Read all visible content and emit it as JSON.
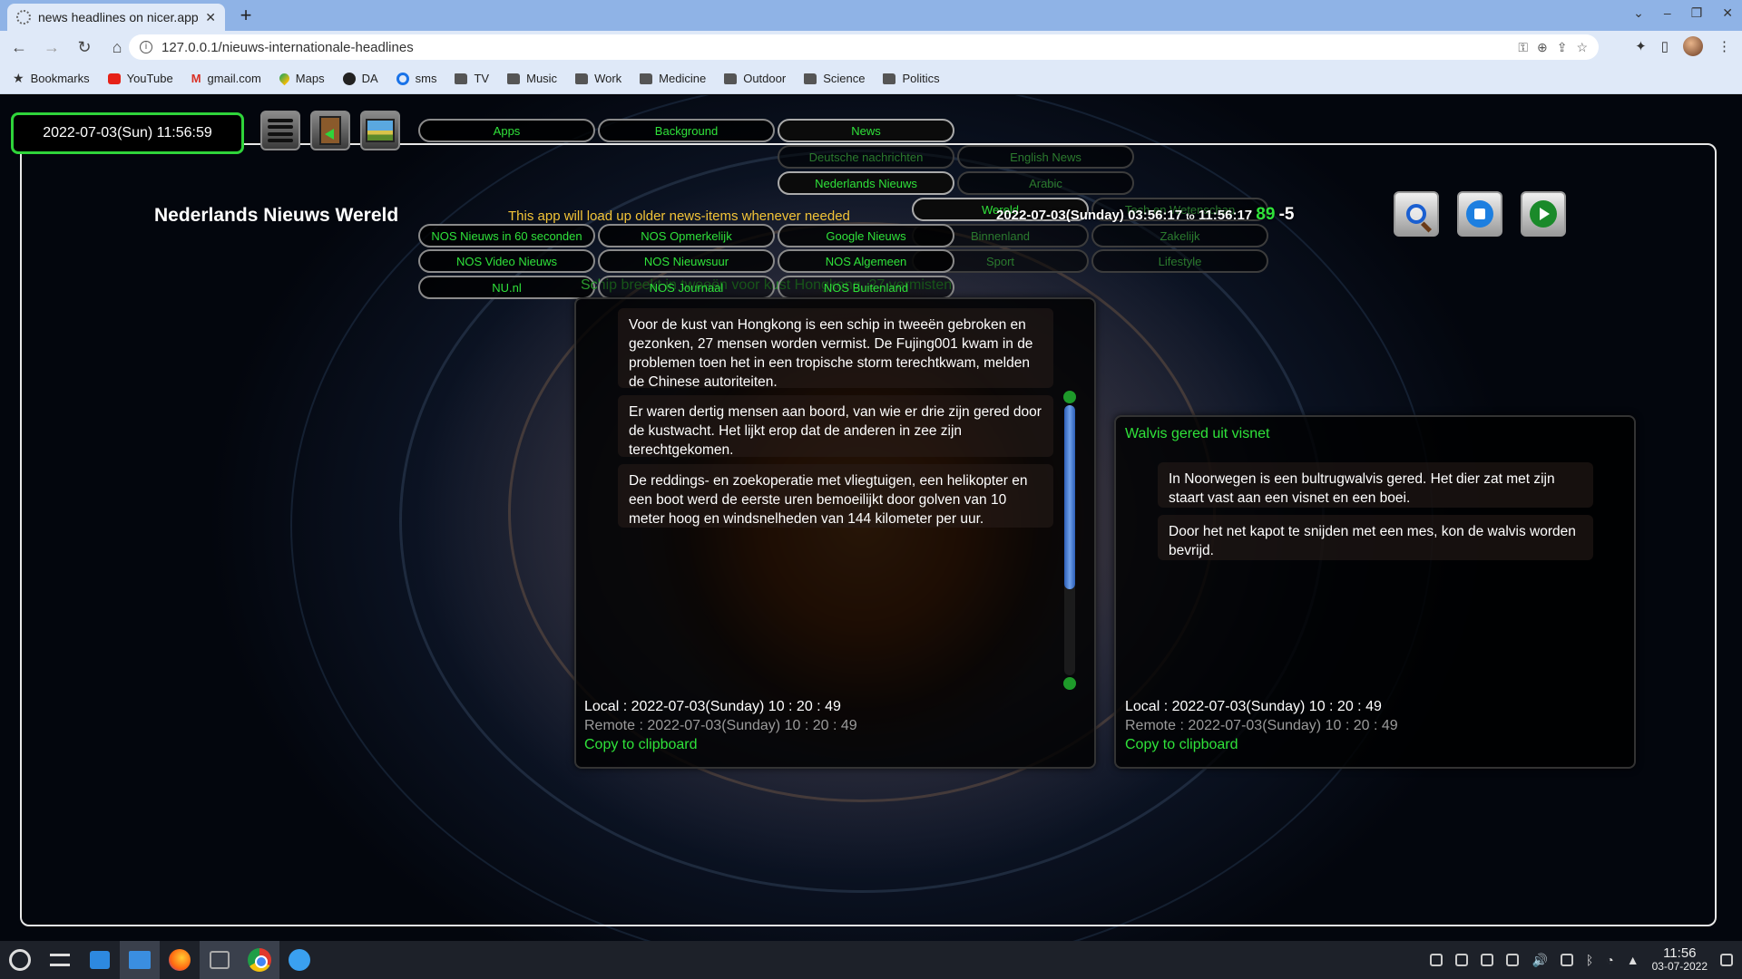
{
  "browser": {
    "tab_title": "news headlines on nicer.app",
    "url": "127.0.0.1/nieuws-internationale-headlines",
    "bookmarks": [
      "Bookmarks",
      "YouTube",
      "gmail.com",
      "Maps",
      "DA",
      "sms",
      "TV",
      "Music",
      "Work",
      "Medicine",
      "Outdoor",
      "Science",
      "Politics"
    ]
  },
  "page": {
    "clock": "2022-07-03(Sun) 11:56:59",
    "app_title": "Nederlands Nieuws Wereld",
    "info_text": "This app will load up older news-items whenever needed",
    "timeline": {
      "start": "2022-07-03(Sunday) 03:56:17",
      "to": "to",
      "end": "11:56:17",
      "count": "89",
      "offset": "-5"
    },
    "ghost_headline": "Schip breekt in tweeën voor kust Hongkong, 27 vermisten",
    "top_menu": [
      "Apps",
      "Background",
      "News"
    ],
    "news_submenu": [
      "Deutsche nachrichten",
      "English News",
      "Nederlands Nieuws",
      "Arabic"
    ],
    "nl_categories": [
      "Wereld",
      "Tech en Wetenschap",
      "Binnenland",
      "Zakelijk",
      "Sport",
      "Lifestyle"
    ],
    "feeds": [
      [
        "NOS Nieuws in 60 seconden",
        "NOS Opmerkelijk",
        "Google Nieuws"
      ],
      [
        "NOS Video Nieuws",
        "NOS Nieuwsuur",
        "NOS Algemeen"
      ],
      [
        "NU.nl",
        "NOS Journaal",
        "NOS Buitenland"
      ]
    ],
    "cards": [
      {
        "title": "Schip breekt in tweeën voor kust Hongkong, 27 vermisten",
        "paragraphs": [
          "Voor de kust van Hongkong is een schip in tweeën gebroken en gezonken, 27 mensen worden vermist. De Fujing001 kwam in de problemen toen het in een tropische storm terechtkwam, melden de Chinese autoriteiten.",
          "Er waren dertig mensen aan boord, van wie er drie zijn gered door de kustwacht. Het lijkt erop dat de anderen in zee zijn terechtgekomen.",
          "De reddings- en zoekoperatie met vliegtuigen, een helikopter en een boot werd de eerste uren bemoeilijkt door golven van 10 meter hoog en windsnelheden van 144 kilometer per uur."
        ],
        "local": "Local : 2022-07-03(Sunday) 10 : 20 : 49",
        "remote": "Remote : 2022-07-03(Sunday) 10 : 20 : 49",
        "copy": "Copy to clipboard",
        "scroll_position": 0.0,
        "scroll_visible_fraction": 0.68
      },
      {
        "title": "Walvis gered uit visnet",
        "paragraphs": [
          "In Noorwegen is een bultrugwalvis gered. Het dier zat met zijn staart vast aan een visnet en een boei.",
          "Door het net kapot te snijden met een mes, kon de walvis worden bevrijd."
        ],
        "local": "Local : 2022-07-03(Sunday) 10 : 20 : 49",
        "remote": "Remote : 2022-07-03(Sunday) 10 : 20 : 49",
        "copy": "Copy to clipboard"
      }
    ]
  },
  "taskbar": {
    "time": "11:56",
    "date": "03-07-2022"
  },
  "colors": {
    "accent_green": "#2fe23a",
    "info_yellow": "#f3c437",
    "chrome_bg": "#dfe9f8"
  }
}
